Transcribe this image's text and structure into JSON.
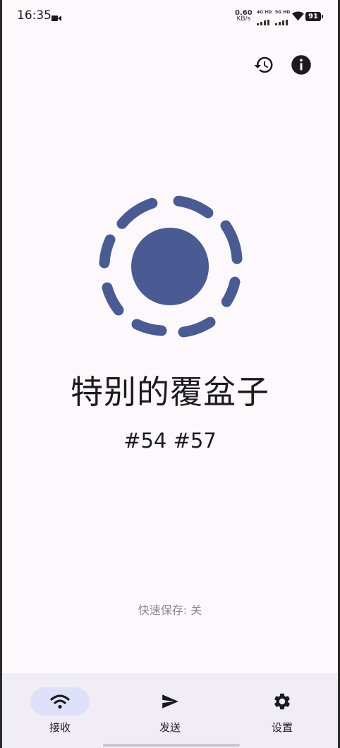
{
  "status_bar": {
    "time": "16:35",
    "net_speed_value": "0.60",
    "net_speed_unit": "KB/s",
    "signal_1_label": "4G HD",
    "signal_2_label": "5G HD",
    "battery": "91"
  },
  "device": {
    "name": "特别的覆盆子",
    "ids": "#54 #57"
  },
  "quick_save": "快速保存: 关",
  "nav": {
    "items": [
      {
        "label": "接收",
        "icon": "wifi-icon",
        "active": true
      },
      {
        "label": "发送",
        "icon": "send-icon",
        "active": false
      },
      {
        "label": "设置",
        "icon": "gear-icon",
        "active": false
      }
    ]
  },
  "colors": {
    "accent": "#4a5a92",
    "background": "#fcf8fc",
    "nav_background": "#f1edf6",
    "active_pill": "#dde0f8",
    "muted_text": "#8a8890"
  }
}
